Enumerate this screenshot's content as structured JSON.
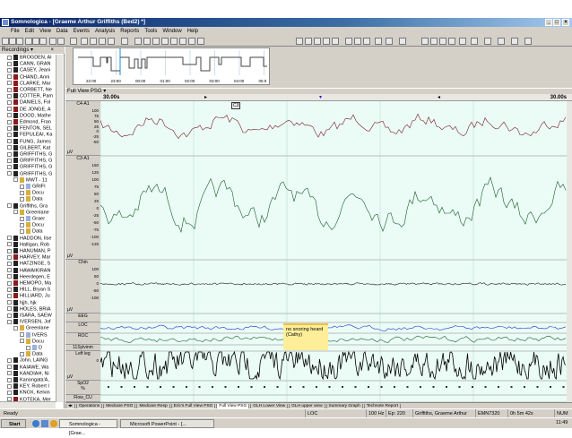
{
  "window": {
    "title": "Somnologica - [Graeme Arthur Griffiths (Bed2) *]"
  },
  "menu": [
    "File",
    "Edit",
    "View",
    "Data",
    "Events",
    "Analysis",
    "Reports",
    "Tools",
    "Window",
    "Help"
  ],
  "sidebar": {
    "header": "Recordings ▾",
    "close": "×",
    "items": [
      {
        "label": "BROGDEN, Al",
        "lvl": 0,
        "ic": "k"
      },
      {
        "label": "CANN, GRAN",
        "lvl": 0,
        "ic": "k"
      },
      {
        "label": "CASEY, Jeani",
        "lvl": 0,
        "ic": "k"
      },
      {
        "label": "CHAND, Anni",
        "lvl": 0,
        "ic": "r"
      },
      {
        "label": "CLARKE, Mar",
        "lvl": 0,
        "ic": "r"
      },
      {
        "label": "CORBETT, Ne",
        "lvl": 0,
        "ic": "r"
      },
      {
        "label": "COTTER, Pam",
        "lvl": 0,
        "ic": "k"
      },
      {
        "label": "DANIELS, Fol",
        "lvl": 0,
        "ic": "r"
      },
      {
        "label": "DE JONGE, A",
        "lvl": 0,
        "ic": "r"
      },
      {
        "label": "DOOD, Mathe",
        "lvl": 0,
        "ic": "k"
      },
      {
        "label": "Edmond, Fran",
        "lvl": 0,
        "ic": "r"
      },
      {
        "label": "FENTON, SEL",
        "lvl": 0,
        "ic": "k"
      },
      {
        "label": "FEPULEAI, Ka",
        "lvl": 0,
        "ic": "k"
      },
      {
        "label": "FUNG, James",
        "lvl": 0,
        "ic": "k"
      },
      {
        "label": "GILBERT, Kat",
        "lvl": 0,
        "ic": "k"
      },
      {
        "label": "GRIFFITHS, G",
        "lvl": 0,
        "ic": "k"
      },
      {
        "label": "GRIFFITHS, G",
        "lvl": 0,
        "ic": "k"
      },
      {
        "label": "GRIFFITHS, G",
        "lvl": 0,
        "ic": "k"
      },
      {
        "label": "GRIFFITHS, G",
        "lvl": 0,
        "ic": "k"
      },
      {
        "label": "MWT - 11",
        "lvl": 1,
        "ic": "f"
      },
      {
        "label": "GRIFI",
        "lvl": 2,
        "ic": "d"
      },
      {
        "label": "Docu",
        "lvl": 2,
        "ic": "f"
      },
      {
        "label": "Data",
        "lvl": 2,
        "ic": "f"
      },
      {
        "label": "Griffiths, Gra",
        "lvl": 0,
        "ic": "k"
      },
      {
        "label": "Greenlane",
        "lvl": 1,
        "ic": "f"
      },
      {
        "label": "Graer",
        "lvl": 2,
        "ic": "d"
      },
      {
        "label": "Docu",
        "lvl": 2,
        "ic": "f"
      },
      {
        "label": "Data",
        "lvl": 2,
        "ic": "f"
      },
      {
        "label": "HADDON, Ilse",
        "lvl": 0,
        "ic": "k"
      },
      {
        "label": "Halligan, Rob",
        "lvl": 0,
        "ic": "k"
      },
      {
        "label": "HANUMAN, P",
        "lvl": 0,
        "ic": "k"
      },
      {
        "label": "HARVEY, Mar",
        "lvl": 0,
        "ic": "r"
      },
      {
        "label": "HATZINGE, S",
        "lvl": 0,
        "ic": "k"
      },
      {
        "label": "HAWAIKIRAN",
        "lvl": 0,
        "ic": "k"
      },
      {
        "label": "Heerdegen, E",
        "lvl": 0,
        "ic": "k"
      },
      {
        "label": "HEMOPO, Ma",
        "lvl": 0,
        "ic": "r"
      },
      {
        "label": "HILL, Bryan S",
        "lvl": 0,
        "ic": "k"
      },
      {
        "label": "HILLIARD, Ju",
        "lvl": 0,
        "ic": "r"
      },
      {
        "label": "hjjh, hjk",
        "lvl": 0,
        "ic": "k"
      },
      {
        "label": "HOLES, BRIA",
        "lvl": 0,
        "ic": "k"
      },
      {
        "label": "ISARA, SAEW",
        "lvl": 0,
        "ic": "k"
      },
      {
        "label": "IVERSEN, Jof",
        "lvl": 0,
        "ic": "k"
      },
      {
        "label": "Greenlane",
        "lvl": 1,
        "ic": "f"
      },
      {
        "label": "IVERS",
        "lvl": 2,
        "ic": "d"
      },
      {
        "label": "Docu",
        "lvl": 2,
        "ic": "f"
      },
      {
        "label": "D",
        "lvl": 3,
        "ic": "d"
      },
      {
        "label": "Data",
        "lvl": 2,
        "ic": "f"
      },
      {
        "label": "John, LAING",
        "lvl": 0,
        "ic": "k"
      },
      {
        "label": "KAIAWE, Wa",
        "lvl": 0,
        "ic": "k"
      },
      {
        "label": "KANDIAH, Ni",
        "lvl": 0,
        "ic": "k"
      },
      {
        "label": "Kanongata'A,",
        "lvl": 0,
        "ic": "k"
      },
      {
        "label": "KEY, Robert I",
        "lvl": 0,
        "ic": "k"
      },
      {
        "label": "KNOX, Kelvin",
        "lvl": 0,
        "ic": "k"
      },
      {
        "label": "KOTEKA, Mer",
        "lvl": 0,
        "ic": "r"
      }
    ]
  },
  "hypnogram": {
    "times": [
      "22:00",
      "23:00",
      "00:00",
      "01:00",
      "02:00",
      "03:00",
      "04:00",
      "05:0"
    ]
  },
  "view": {
    "label": "Full View PSG ▾",
    "time_left": "30.00s",
    "time_right": "30.00s",
    "marker": "C3"
  },
  "channels": [
    {
      "name": "C4-A1",
      "unit": "µV",
      "ticks": [
        "100",
        "75",
        "50",
        "25",
        "0",
        "-25",
        "-50"
      ],
      "color": "#7a1a2a"
    },
    {
      "name": "C3-A1",
      "unit": "µV",
      "ticks": [
        "150",
        "125",
        "100",
        "75",
        "50",
        "25",
        "0",
        "-25",
        "-50",
        "-75",
        "-100",
        "-125"
      ],
      "color": "#1a5a2a"
    },
    {
      "name": "Chin",
      "unit": "µV",
      "ticks": [
        "100",
        "50",
        "0",
        "-50",
        "-100"
      ],
      "color": "#222222"
    },
    {
      "name": "EEG"
    },
    {
      "name": "LOC",
      "color": "#2233cc"
    },
    {
      "name": "ROC",
      "color": "#1a5a2a"
    },
    {
      "name": "11Sylvinm"
    },
    {
      "name": "Left leg",
      "unit": "µV",
      "ticks": [
        "0"
      ],
      "color": "#000000"
    },
    {
      "name": "SpO2",
      "sub": "%"
    },
    {
      "name": "Flow_CU"
    }
  ],
  "annotation": {
    "text": "no snoring heard (Cathy)"
  },
  "tabs": [
    "Operations",
    "Medcare PSG",
    "Medcare Resp",
    "Eric's Full View PSG",
    "Full View PSG",
    "GLH Lower View",
    "GLH upper view",
    "Summary Graph",
    "Technote Report"
  ],
  "active_tab": "Full View PSG",
  "status": {
    "ready": "Ready",
    "loc": "LOC",
    "freq": "100 Hz",
    "epoch": "Ep: 220",
    "patient": "Griffiths, Graeme Arthur",
    "device": "EMN7320",
    "duration": "0h 5m 42s",
    "num": "NUM"
  },
  "taskbar": {
    "start": "Start",
    "tasks": [
      "Somnologica - [Grae...",
      "Microsoft PowerPoint - [..."
    ],
    "clock": "11:49"
  }
}
